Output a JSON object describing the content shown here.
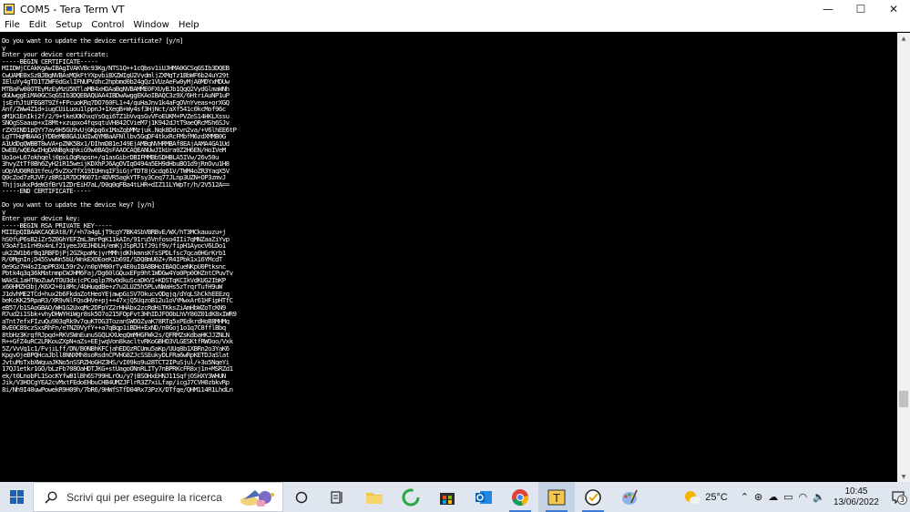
{
  "window": {
    "title": "COM5 - Tera Term VT",
    "controls": {
      "minimize": "—",
      "maximize": "☐",
      "close": "✕"
    }
  },
  "menu": [
    "File",
    "Edit",
    "Setup",
    "Control",
    "Window",
    "Help"
  ],
  "terminal": {
    "lines": [
      "Do you want to update the device certificate? [y/n]",
      "y",
      "Enter your device certificate:",
      "-----BEGIN CERTIFICATE-----",
      "MIIDWjCCAkKgAwIBAgIVAKVBc93Kg/NTS1Q++1cQbsv1iUJHMA0GCSqGSIb3DQEB",
      "CwUAME0xSzBJBgNVBAsMQkFtYXpvbiBXZWIgU2VydmljZXMgTz1BbWF6b24uY29t",
      "IEluYy4gTD1TZWF0dGxlIFNUPVdhc2hpbmd0b24gQz1VUzAeFw0yMjA0MDYxMDUw",
      "MTBaFw00OTEyMzEyMzU5NTlaMB4xHDAaBgNVBAMME0FXUyBJb1QgQ2VydGlmaWNh",
      "dGUwggEiMA0GCSqGSIb3DQEBAQUAA4IBDwAwggEKAoIBAQC3z9X/6HtriAuNP1uP",
      "jsErhJtUFEG8T9Zf+FPcuoKRq7DO760FL1+4/quHaJnv1k4aFgOVnYveas+orXGQ",
      "Anf/2Ww4Z1d+iugCUiLuou1lppnJ+1XegB+Wy4sf3HjNct/aXf541c0kcMof96c",
      "gM1K1EnIkj2f/2/9+tkeUOKhxqYsOgi6TZ1bVvqsGvVFoEUKM+PVZeS14HKLXssu",
      "SNOgSSaaup+xI8Mt+xzupxo4fqsqtuVH842CVieM7j1K942dJtT9aeQRcMSh6SJv",
      "rZX9IND1pQYY7av9H5GU9vUjGKpg6x1MaZqbMMzjuk.Nqk8Ddcvn2va/+V6lhEE6tP",
      "LgTTHqMBAAGjYDBeMB8GA1UdIwQYMBaAFNllbv5GqDF4tkxRcFMbfM6zdXMMB0G",
      "A1UdDgQWBBT8wVA+pZNK5Bx1/DIhmDB1eJ49EjAMBgNVHRMBAf8EAjAAMA4GA1Ud",
      "DwEB/wQEAwIHgDANBgkqhkiG9w0BAQsFAAOCAQEANUwJIkUra0Z2H6EN/HoIVeM",
      "Uo1o+L67okhqelj0pxLOgRapsn+/q1asGibrDBIFMMBbSDHBLA5IVw/26v50u",
      "3hvyZtTf0Bh6ZyH2iR15weijKDXhPJ6AgOVIqO494a5EH9dHbuBO1d9jRnOvu1H8",
      "uOpVUO0R63tfeu/5vZXxTfX19IUHnqIF3iGjrTDT8jGcdg61V/TWM4oZR3YagX5V",
      "Q0cZod7zRJVF/z8RS1R7DCM6071r4DVR5agkYTFsy3Ceq77JLnp3UZN+OP3zmvJ",
      "ThjjsukxPdeW3fBrV1ZDrEiH7aL/D0g0qFBa4tLHR+dIZ11LYWpTr/h/2V512A==",
      "-----END CERTIFICATE-----",
      "",
      "Do you want to update the device key? [y/n]",
      "y",
      "Enter your device key:",
      "-----BEGIN RSA PRIVATE KEY-----",
      "MIIEpQIBAAKCAQEAt8/F/+h7a4gLjT9cgY7BK4SbVBRBvE/WX/hT3MCkauuzu+j",
      "hS0fuP6sB2iZr5Z0GhYEFZmL3mrPgK11kAIn/91ru5Vnfoso4IIi7qMNZaaZiYvp",
      "V3oAf1s1rH9x4nLf21yeeJXEJHDLH/emKjJSpRJ1fJ9if9v/fipH1AyocV6LDo1",
      "uk2ZW1b6rBq1RBFDjPj2GZkpaMcjyrMMhjdKhkmnsKfsSPDLfsc7qca0HGrKrb1",
      "R/0MgnIn;D45SvwNn5bU/WnkEXOEoeK1b69I/SDQ8mU0Z+/R4IPbk1x16YMcdT",
      "Oe9Gz7H4s2IapPR3XL59r2v/n0pYM00rTy4E0uIBA8BHoIBAQCueNKpU0Ptksnc",
      "Pbtk4q3q36kMatnmpCWJHM6Faj/Dg60lGQuxEFp9ht1WDGw4Yo0Pp0OHZntCPuvTv",
      "WAkSL1aHTNoZuwVTOU3dxjcPCoglp7Rv0dkuScaDKVI+KDSTqKCIkVdKUG2IbKP",
      "x60HMZH3bj/K6X2+0i8Mc/4bHuqdBe+z7u2LUZ5h5PLvNWaHs5zTrqrTufH9uW",
      "J1dvhME2TCd+hux2b6FkdaZotHeoYEjawpGiSV7OkucvODgjg/dYqLShCkhEEEzq",
      "beKcKK25RpaR3/XR9vNlFQsdHVe+pj++47xjQ5UqzoB12u1oVYMwxAr61HFipHTfC",
      "eB57/b1SAoGBAO/WH1G2UxqMc2DFpYZ2rHHAbx2zcRdHiTKksZiAmHbWZoTcKN9",
      "R7ud2i1Sbk+vhyDHWYHiWgr8sk5O7o215FOpFvt3HhIDJFOObLhVY80Z01dK8xIWR9",
      "aTnt7efxFIzuQu903gRk9v7guKTOG3TozanSWOOZyaK78RTq5xPEdkrdHoB8MHMq",
      "BvE0C89czSxsRhFn/eTNZ0VyfY++a7qBqp1iBDH+ExND/n0Goj1o1q7C8fflBbq",
      "8tbHz3KrgfRJpgd+RKVSWnEunuSGQLKXUegQmMHGFWk2s/QFRMZsKdbaHKJJZNLN",
      "R++GfZ4uRC2LRKouZXpN+aZs+EEjwqVon8kacltvRKoGBHO3VLGESKtfRWOoo/Vxk",
      "5Z/VvVg1c1/FvjiLff/DN/B0NBhKFCjahEDQzRCUmu5aKp/UUq8b1XBRn2o3YaK6",
      "KpgvOjeBPQHcaJbll8NNXMh8soRsdnCPVHG8ZJcSSEukyDLFRa6wRpKETDJaSlat",
      "JvtuMsTxbXWguaJKNo5nSSRZHoGHZ3HS/vI09ko9u28TCT2IPuSjul/+3o5NqeYi",
      "17QJ1etkr1GO/bLzFb708OaHDTJKG+stUagoONnRLITy7nBPRKcFR8xj1n+MSRZd1",
      "ek/t0LnobFL1SocKYfwB1lBh6S799HLrOu/y7jBSOHxEHNJ11SqfjOSHXY3WHUN",
      "Jik/V3HOCgYEA2cvMxtFEdoEHbuCHB4UMZJFlrR3Z7xiLfap/icgJ7CVH0zbkvRp",
      "8i/Nh9I40uwPowekR9H09h/7bR6/9HWfSTfD04Rx73PzX/DTfqe/QHM114R1LhdLn"
    ]
  },
  "search": {
    "placeholder": "Scrivi qui per eseguire la ricerca"
  },
  "taskbar_icons": [
    {
      "name": "task-view-icon"
    },
    {
      "name": "widgets-icon"
    },
    {
      "name": "file-explorer-icon"
    },
    {
      "name": "refresh-app-icon"
    },
    {
      "name": "store-icon"
    },
    {
      "name": "outlook-icon"
    },
    {
      "name": "chrome-icon"
    },
    {
      "name": "teraterm-icon"
    },
    {
      "name": "check-app-icon"
    },
    {
      "name": "paint-app-icon"
    }
  ],
  "tray": {
    "temperature": "25°C",
    "time": "10:45",
    "date": "13/06/2022",
    "notification_count": "3"
  },
  "colors": {
    "terminal_bg": "#000000",
    "terminal_fg": "#ffffff",
    "taskbar_bg": "#dfe6ef",
    "accent": "#3e7bd6"
  }
}
